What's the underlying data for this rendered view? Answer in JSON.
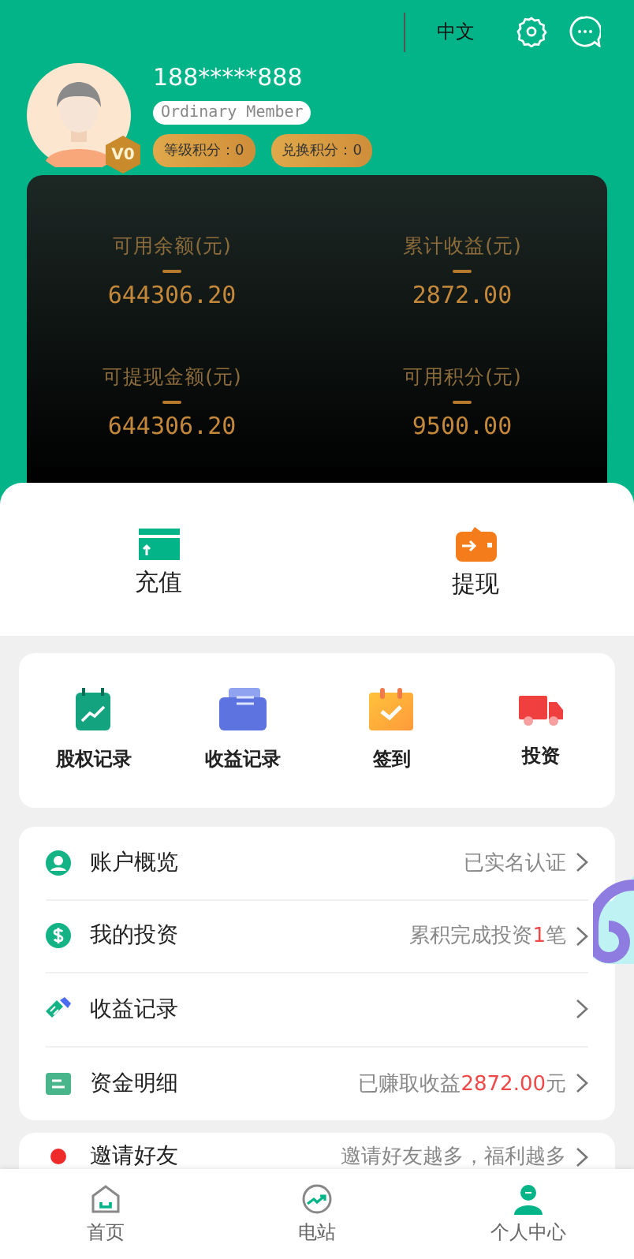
{
  "header": {
    "language": "中文",
    "phone": "188*****888",
    "member_level": "Ordinary Member",
    "avatar_badge": "V0",
    "points": [
      "等级积分：0",
      "兑换积分：0"
    ]
  },
  "balances": [
    {
      "label": "可用余额(元)",
      "value": "644306.20"
    },
    {
      "label": "累计收益(元)",
      "value": "2872.00"
    },
    {
      "label": "可提现金额(元)",
      "value": "644306.20"
    },
    {
      "label": "可用积分(元)",
      "value": "9500.00"
    }
  ],
  "actions": [
    {
      "label": "充值",
      "kind": "recharge"
    },
    {
      "label": "提现",
      "kind": "withdraw"
    }
  ],
  "shortcuts": [
    {
      "label": "股权记录",
      "kind": "equity"
    },
    {
      "label": "收益记录",
      "kind": "income"
    },
    {
      "label": "签到",
      "kind": "checkin"
    },
    {
      "label": "投资",
      "kind": "invest"
    }
  ],
  "menu": [
    {
      "label": "账户概览",
      "kind": "account",
      "status": [
        {
          "text": "已实名认证",
          "highlight": false
        }
      ]
    },
    {
      "label": "我的投资",
      "kind": "investment",
      "status": [
        {
          "text": "累积完成投资",
          "highlight": false
        },
        {
          "text": "1",
          "highlight": true
        },
        {
          "text": "笔",
          "highlight": false
        }
      ]
    },
    {
      "label": "收益记录",
      "kind": "income"
    },
    {
      "label": "资金明细",
      "kind": "funds",
      "status": [
        {
          "text": "已赚取收益",
          "highlight": false
        },
        {
          "text": "2872.00",
          "highlight": true
        },
        {
          "text": "元",
          "highlight": false
        }
      ]
    }
  ],
  "invite": {
    "label": "邀请好友",
    "status": "邀请好友越多，福利越多"
  },
  "tabs": [
    {
      "label": "首页",
      "kind": "home",
      "selected": false
    },
    {
      "label": "电站",
      "kind": "station",
      "selected": false
    },
    {
      "label": "个人中心",
      "kind": "profile",
      "selected": true
    }
  ]
}
